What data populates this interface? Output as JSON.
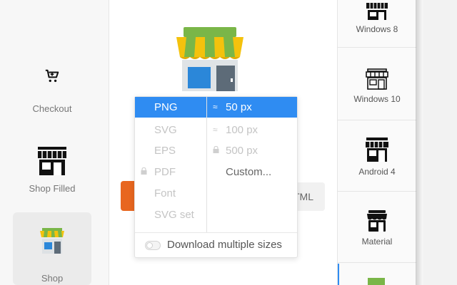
{
  "left_panel": {
    "items": [
      {
        "label": "Checkout",
        "icon": "cart-icon"
      },
      {
        "label": "Shop Filled",
        "icon": "shop-filled-icon"
      },
      {
        "label": "Shop",
        "icon": "shop-color-icon",
        "active": true
      }
    ]
  },
  "center": {
    "preview_icon": "shop-color-icon",
    "html_button_label": "TML"
  },
  "download_menu": {
    "formats": [
      {
        "label": "PNG",
        "selected": true,
        "locked": false
      },
      {
        "label": "SVG",
        "selected": false,
        "locked": false
      },
      {
        "label": "EPS",
        "selected": false,
        "locked": false
      },
      {
        "label": "PDF",
        "selected": false,
        "locked": true
      },
      {
        "label": "Font",
        "selected": false,
        "locked": false
      },
      {
        "label": "SVG set",
        "selected": false,
        "locked": false
      }
    ],
    "sizes": [
      {
        "label": "50 px",
        "prefix": "≈",
        "selected": true
      },
      {
        "label": "100 px",
        "prefix": "≈",
        "selected": false
      },
      {
        "label": "500 px",
        "prefix": "lock",
        "selected": false
      },
      {
        "label": "Custom...",
        "prefix": "",
        "selected": false
      }
    ],
    "multiple_sizes_label": "Download multiple sizes",
    "multiple_sizes_enabled": false
  },
  "right_panel": {
    "styles": [
      {
        "label": "Windows 8",
        "icon": "shop-win8-icon"
      },
      {
        "label": "Windows 10",
        "icon": "shop-win10-icon"
      },
      {
        "label": "Android 4",
        "icon": "shop-android-icon"
      },
      {
        "label": "Material",
        "icon": "shop-material-icon"
      }
    ]
  },
  "colors": {
    "accent": "#2f8cf2",
    "orange": "#e8661f",
    "awning_green": "#7ab648",
    "awning_yellow": "#f4c20d",
    "window_blue": "#2b87d9"
  }
}
